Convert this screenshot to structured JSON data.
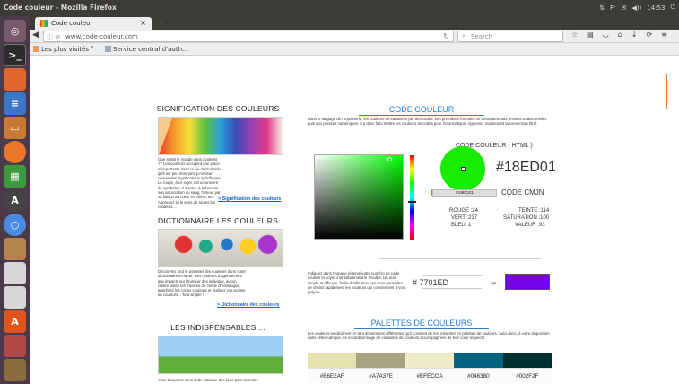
{
  "system": {
    "window_title": "Code couleur - Mozilla Firefox",
    "tray_text": [
      "⇅",
      "Fr",
      "✉",
      "◀))",
      "14:53",
      "⏻"
    ],
    "launcher_icons": [
      "ubuntu-icon",
      "terminal-icon",
      "files-icon",
      "writer-icon",
      "impress-icon",
      "firefox-icon",
      "calc-icon",
      "software-center-icon",
      "chromium-icon",
      "gimp-icon",
      "drive-icon",
      "drive-icon-2",
      "store-icon",
      "settings-icon",
      "trash-icon"
    ]
  },
  "browser": {
    "tab_title": "Code couleur",
    "url": "www.code-couleur.com",
    "url_prefix": "ⓘ ⚙",
    "search_placeholder": "Search",
    "bookmarks": [
      "Les plus visités ˅",
      "Service central d'auth…"
    ]
  },
  "sidebar": {
    "sec1_title": "SIGNIFICATION DES COULEURS",
    "sec1_text": "Que serait le monde sans couleurs ?? Les couleurs occupent une place si importante dans la vie de l'individu qu'il est peu étonnant qu'on leur octroie des significations spécifiques. Le rouge, à ce sujet, est un univers de symboles. Il incarne à la fois par son association au sang, l'amour par sa liaison au cœur, la colère, etc. Apprenez ici le sens de toutes les couleurs....",
    "sec1_link": "> Signification des couleurs",
    "sec2_title": "DICTIONNAIRE LES COULEURS",
    "sec2_text": "Découvrez tout le potentiel des couleurs dans notre dictionnaire en ligne. Des couleurs d'agencement aux impacts sur l'humeur des individus, aucun critère utilisé les théories du cercle chromatique, apprênez les codes couleurs et réalisez vos projets en couleurs... Tout simple !",
    "sec2_link": "> Dictionnaire des couleurs",
    "sec3_title": "LES INDISPENSABLES ...",
    "sec3_text": "Vous trouverez sous cette rubrique des liens pour accroitre"
  },
  "main": {
    "title": "CODE COULEUR",
    "intro": "Dans le langage de l'imprimerie, les couleurs se traduisent par des codes. Les premières formules se destinaient aux presses traditionnelles puis aux presses numériques. Il a donc fallu mettre les couleurs de codes pour l'informatique. Apprenez maintenant la conversion html.",
    "html_label": "CODE COULEUR ( HTML )",
    "hex": "#18ED01",
    "hex_input": "#18ED01",
    "cmjn_label": "CODE CMJN",
    "rgb": [
      "ROUGE :24",
      "VERT :237",
      "BLEU :1"
    ],
    "hsv": [
      "TEINTE :114",
      "SATURATION :100",
      "VALEUR :93"
    ],
    "convert_text": "Indiquez dans l'espace réservé votre numéro de code couleur et voyez immédiatement le résultat. Un outil simple et efficace, facile d'utilisation, qui vous permettra de choisir rapidement les couleurs qui conviennent à vos projets.",
    "convert_value": "# 7701ED",
    "palette_title": "PALETTES DE COULEURS",
    "palette_text": "Les couleurs se déclinent en tant de versions différentes qu'il convient de les présenter en palettes de couleurs. Voici donc, à votre disposition dans cette rubrique, un échantillonnage de centaines de couleurs accompagnées de leur code respectif.",
    "palette": [
      {
        "hex": "#E6E2AF",
        "color": "#E6E2AF"
      },
      {
        "hex": "#A7A37E",
        "color": "#A7A37E"
      },
      {
        "hex": "#EFECCA",
        "color": "#EFECCA"
      },
      {
        "hex": "#046380",
        "color": "#046380"
      },
      {
        "hex": "#002F2F",
        "color": "#002F2F"
      }
    ]
  },
  "colors": {
    "accent": "#2a7fd4",
    "picked": "#18ed01",
    "converted": "#7701ed"
  }
}
